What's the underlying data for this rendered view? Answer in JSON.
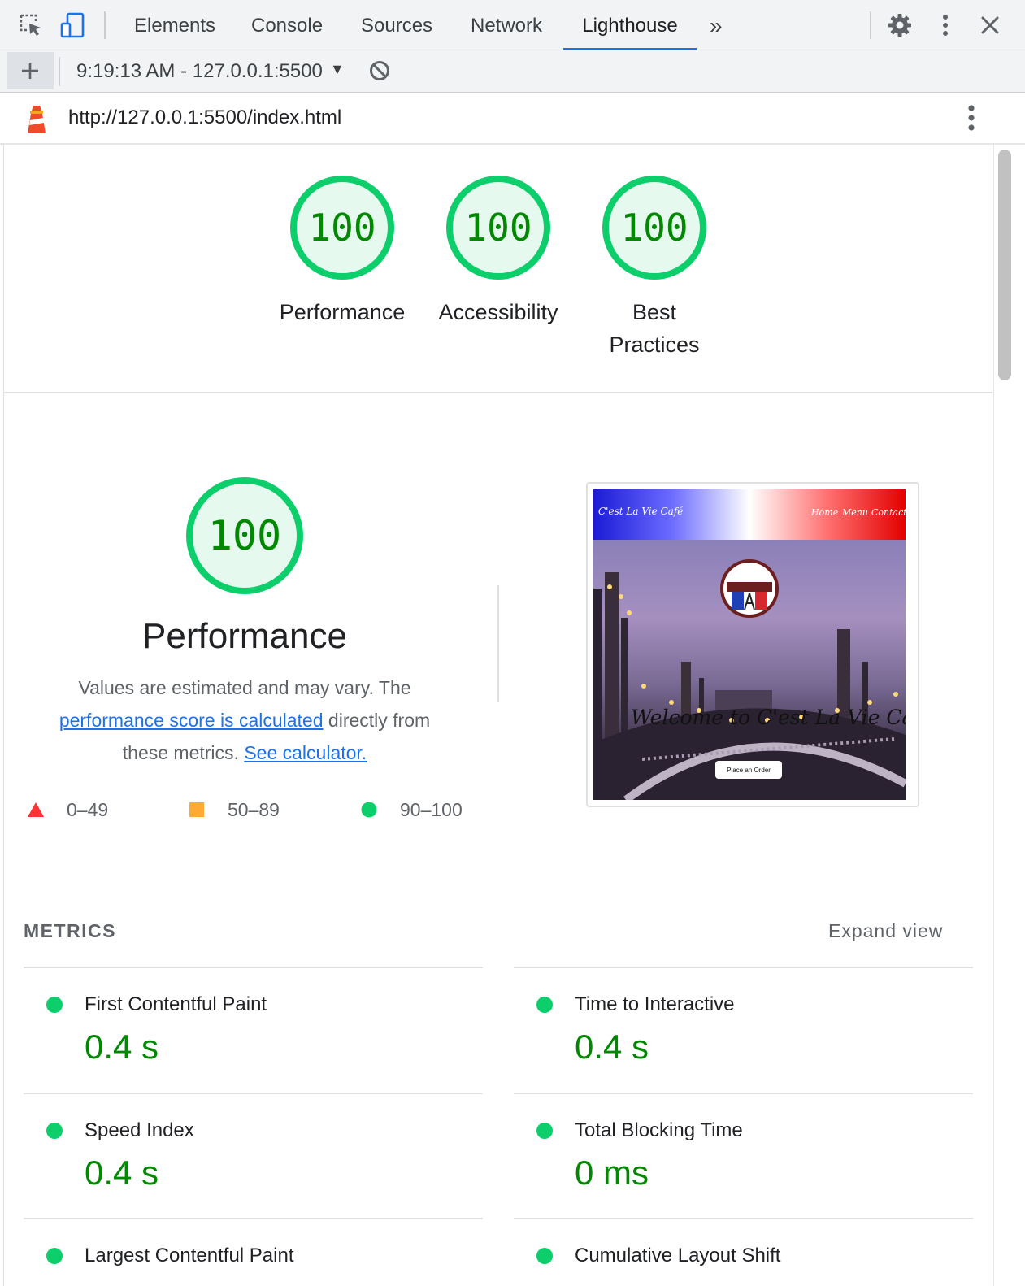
{
  "devtools": {
    "tabs": [
      {
        "label": "Elements"
      },
      {
        "label": "Console"
      },
      {
        "label": "Sources"
      },
      {
        "label": "Network"
      },
      {
        "label": "Lighthouse",
        "active": true
      }
    ],
    "more_tabs_glyph": "»"
  },
  "toolbar": {
    "report_select": "9:19:13 AM - 127.0.0.1:5500"
  },
  "urlbar": {
    "url": "http://127.0.0.1:5500/index.html"
  },
  "scores": [
    {
      "label": "Performance",
      "score": "100"
    },
    {
      "label": "Accessibility",
      "score": "100"
    },
    {
      "label_line1": "Best",
      "label_line2": "Practices",
      "score": "100"
    }
  ],
  "performance": {
    "score": "100",
    "title": "Performance",
    "desc_part1": "Values are estimated and may vary. The",
    "desc_link1": "performance score is calculated",
    "desc_part2": "directly from",
    "desc_part3": "these metrics.",
    "desc_link2": "See calculator.",
    "legend": [
      {
        "range": "0–49",
        "color": "#ff3333"
      },
      {
        "range": "50–89",
        "color": "#ffaa33"
      },
      {
        "range": "90–100",
        "color": "#0cce6b"
      }
    ]
  },
  "screenshot": {
    "brand": "C'est La Vie Café",
    "nav_links": [
      "Home",
      "Menu",
      "Contact"
    ],
    "logo_text": "C'est La Vie Café",
    "headline": "Welcome to C'est La Vie Café",
    "order_button": "Place an Order"
  },
  "metrics": {
    "heading": "METRICS",
    "expand_label": "Expand view",
    "items": [
      {
        "name": "First Contentful Paint",
        "value": "0.4 s"
      },
      {
        "name": "Time to Interactive",
        "value": "0.4 s"
      },
      {
        "name": "Speed Index",
        "value": "0.4 s"
      },
      {
        "name": "Total Blocking Time",
        "value": "0 ms"
      },
      {
        "name": "Largest Contentful Paint",
        "value": ""
      },
      {
        "name": "Cumulative Layout Shift",
        "value": ""
      }
    ]
  },
  "colors": {
    "pass": "#0cce6b",
    "pass_text": "#008800",
    "accent": "#1a73e8"
  }
}
